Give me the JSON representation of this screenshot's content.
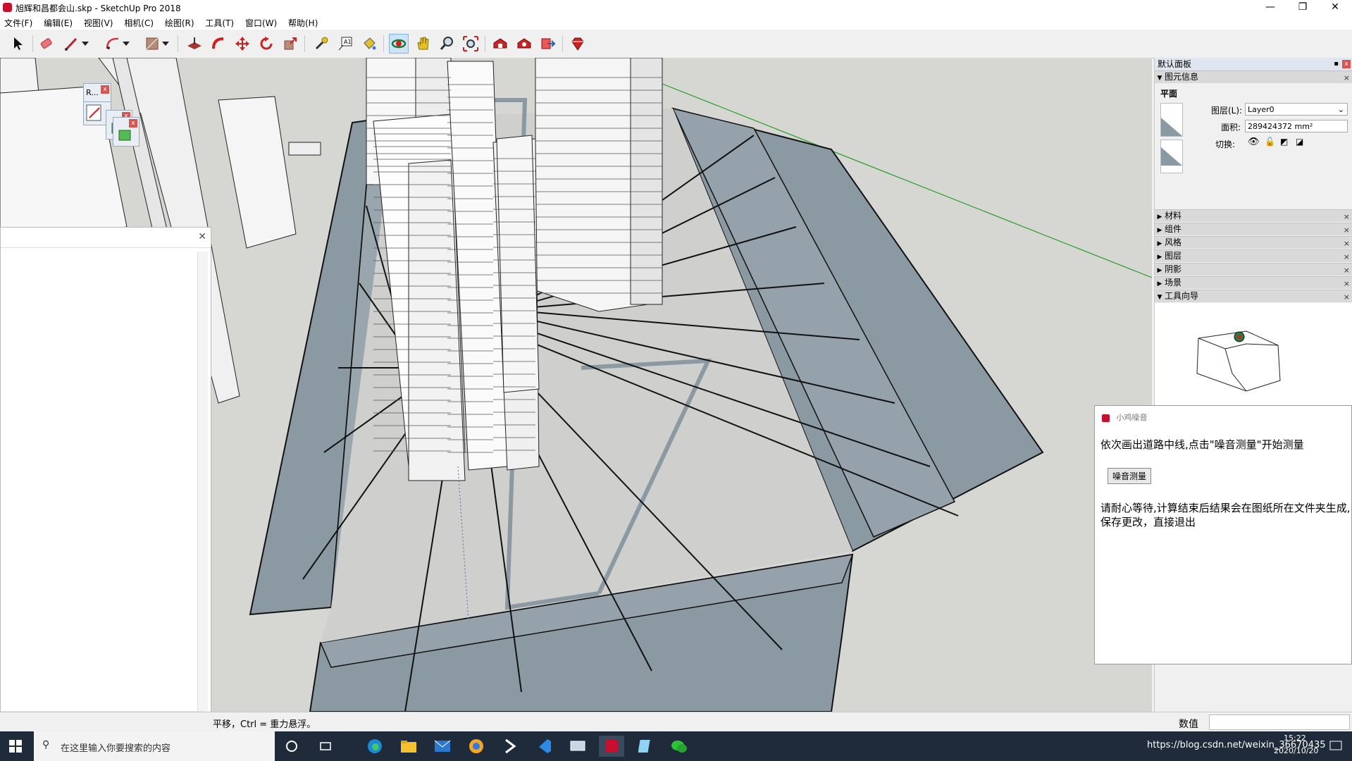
{
  "window": {
    "title": "旭辉和昌都会山.skp - SketchUp Pro 2018",
    "minimize": "—",
    "maximize": "❐",
    "close": "✕"
  },
  "menu": [
    "文件(F)",
    "编辑(E)",
    "视图(V)",
    "相机(C)",
    "绘图(R)",
    "工具(T)",
    "窗口(W)",
    "帮助(H)"
  ],
  "toolbar": {
    "icons": [
      "select-icon",
      "eraser-icon",
      "line-icon",
      "line-dropdown",
      "arc-icon",
      "arc-dropdown",
      "rectangle-icon",
      "rectangle-dropdown",
      "push-pull-icon",
      "follow-me-icon",
      "move-icon",
      "rotate-icon",
      "scale-icon",
      "tape-measure-icon",
      "text-icon",
      "paint-bucket-icon",
      "orbit-icon",
      "pan-icon",
      "zoom-icon",
      "zoom-extents-icon",
      "warehouse-icon",
      "extension-warehouse-icon",
      "send-to-layout-icon",
      "ruby-icon"
    ]
  },
  "mini_toolbars": {
    "ruby_label": "R..."
  },
  "tray": {
    "title": "默认面板",
    "entity_info": {
      "header": "图元信息",
      "type": "平面",
      "layer_label": "图层(L):",
      "layer_value": "Layer0",
      "area_label": "面积:",
      "area_value": "289424372 mm²",
      "toggle_label": "切换:"
    },
    "panels": [
      "材料",
      "组件",
      "风格",
      "图层",
      "阴影",
      "场景",
      "工具向导"
    ]
  },
  "plugin": {
    "title": "小鸡噪音",
    "instruction": "依次画出道路中线,点击\"噪音测量\"开始测量",
    "button": "噪音测量",
    "note_line1": "请耐心等待,计算结束后结果会在图纸所在文件夹生成,",
    "note_line2": "保存更改，直接退出"
  },
  "status": {
    "message": "平移，Ctrl = 重力悬浮。",
    "measure_label": "数值",
    "measure_value": ""
  },
  "taskbar": {
    "search_placeholder": "在这里输入你要搜索的内容",
    "time": "15:22",
    "date": "2020/10/20",
    "watermark": "https://blog.csdn.net/weixin_36670435"
  },
  "colors": {
    "viewport_bg": "#d6d6d3",
    "face_blue": "#8b99a3",
    "selection": "#cce4f7",
    "axis_green": "#2aa02a",
    "taskbar": "#1f2b3a"
  }
}
